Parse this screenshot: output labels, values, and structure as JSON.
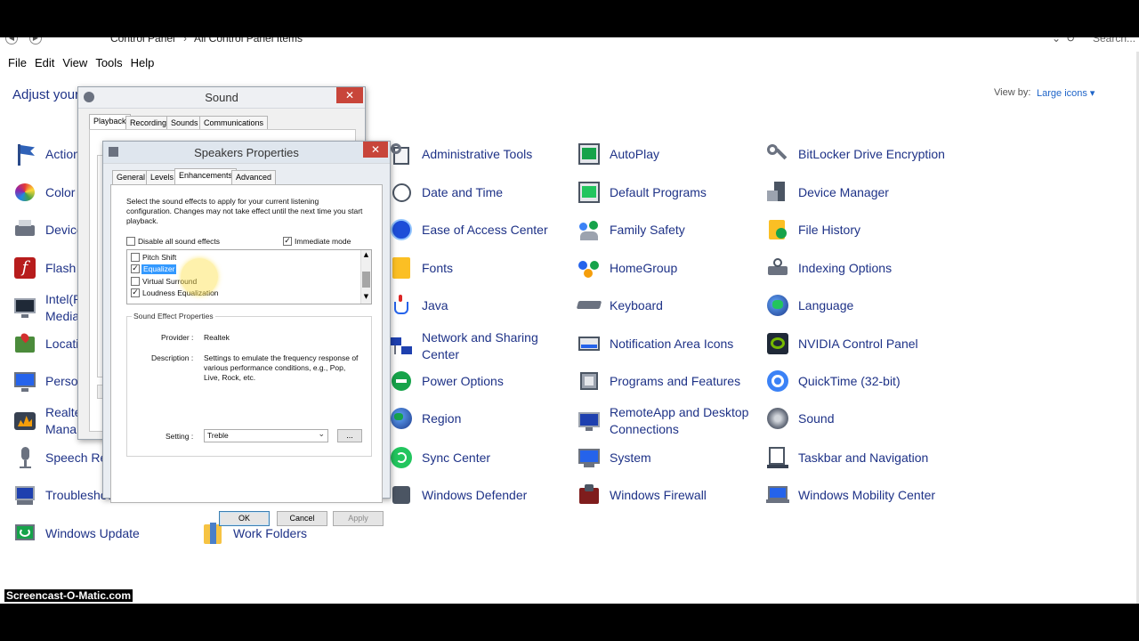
{
  "address": {
    "path_1": "Control Panel",
    "path_2": "All Control Panel Items",
    "search_placeholder": "Search..."
  },
  "menu": [
    "File",
    "Edit",
    "View",
    "Tools",
    "Help"
  ],
  "header": {
    "adjust_text": "Adjust your",
    "view_by_label": "View by:",
    "view_by_value": "Large icons ▾"
  },
  "control_panel_items": {
    "col1": [
      "Action",
      "Color",
      "Device",
      "Flash I",
      "Intel(R) Media",
      "Locati",
      "Person",
      "Realte Mana",
      "Speech Re",
      "Troubleshooting",
      "Windows Update"
    ],
    "col2": [
      "Work Folders"
    ],
    "col3": [
      "Administrative Tools",
      "Date and Time",
      "Ease of Access Center",
      "Fonts",
      "Java",
      "Network and Sharing Center",
      "Power Options",
      "Region",
      "Sync Center",
      "Windows Defender"
    ],
    "col4": [
      "AutoPlay",
      "Default Programs",
      "Family Safety",
      "HomeGroup",
      "Keyboard",
      "Notification Area Icons",
      "Programs and Features",
      "RemoteApp and Desktop Connections",
      "System",
      "Windows Firewall"
    ],
    "col5": [
      "BitLocker Drive Encryption",
      "Device Manager",
      "File History",
      "Indexing Options",
      "Language",
      "NVIDIA Control Panel",
      "QuickTime (32-bit)",
      "Sound",
      "Taskbar and Navigation",
      "Windows Mobility Center"
    ]
  },
  "sound_dialog": {
    "title": "Sound",
    "close": "✕",
    "tabs": [
      "Playback",
      "Recording",
      "Sounds",
      "Communications"
    ]
  },
  "speakers_dialog": {
    "title": "Speakers Properties",
    "close": "✕",
    "tabs": [
      "General",
      "Levels",
      "Enhancements",
      "Advanced"
    ],
    "intro_line1": "Select the sound effects to apply for your current listening",
    "intro_line2": "configuration. Changes may not take effect until the next time you start",
    "intro_line3": "playback.",
    "disable_all_label": "Disable all sound effects",
    "immediate_mode_label": "Immediate mode",
    "effects": [
      {
        "label": "Pitch Shift",
        "checked": false
      },
      {
        "label": "Equalizer",
        "checked": true
      },
      {
        "label": "Virtual Surround",
        "checked": false
      },
      {
        "label": "Loudness Equalization",
        "checked": true
      }
    ],
    "group_label": "Sound Effect Properties",
    "provider_label": "Provider :",
    "provider_value": "Realtek",
    "description_label": "Description :",
    "description_line1": "Settings to emulate the frequency response of",
    "description_line2": "various performance conditions,  e.g., Pop,",
    "description_line3": "Live, Rock, etc.",
    "setting_label": "Setting :",
    "setting_value": "Treble",
    "more_button": "...",
    "ok": "OK",
    "cancel": "Cancel",
    "apply": "Apply"
  },
  "watermark": "Screencast-O-Matic.com"
}
